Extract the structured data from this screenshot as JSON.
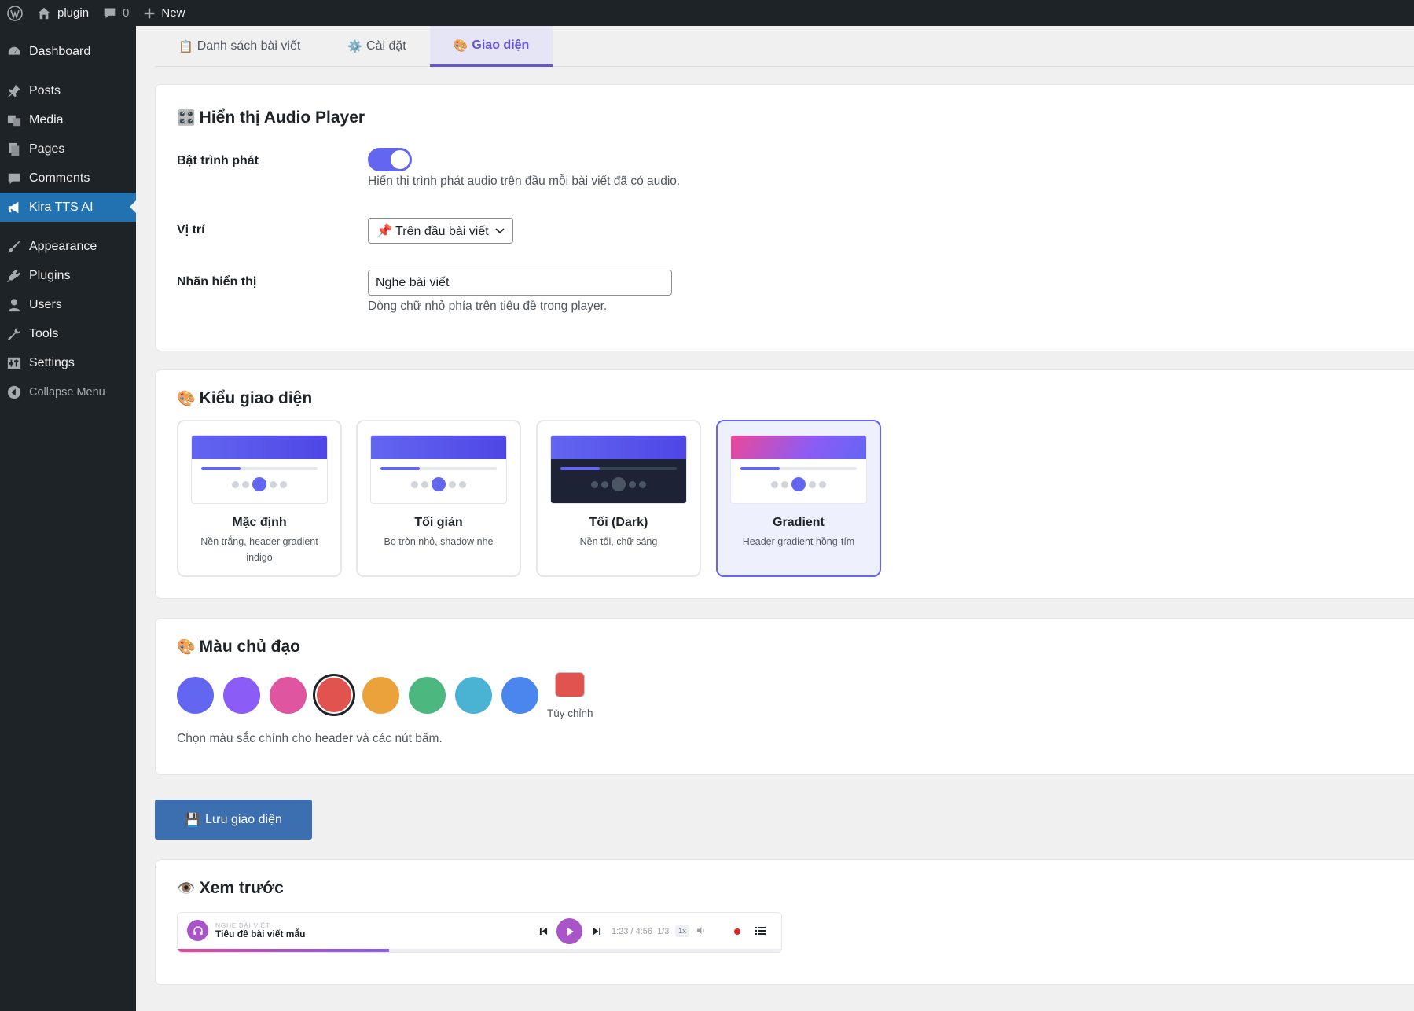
{
  "adminbar": {
    "site_name": "plugin",
    "comments_count": "0",
    "new_label": "New"
  },
  "sidebar": {
    "items": [
      {
        "label": "Dashboard",
        "icon": "dashboard-icon"
      },
      {
        "label": "Posts",
        "icon": "pin-icon"
      },
      {
        "label": "Media",
        "icon": "media-icon"
      },
      {
        "label": "Pages",
        "icon": "pages-icon"
      },
      {
        "label": "Comments",
        "icon": "comments-icon"
      },
      {
        "label": "Kira TTS AI",
        "icon": "megaphone-icon",
        "active": true
      },
      {
        "label": "Appearance",
        "icon": "brush-icon"
      },
      {
        "label": "Plugins",
        "icon": "plug-icon"
      },
      {
        "label": "Users",
        "icon": "user-icon"
      },
      {
        "label": "Tools",
        "icon": "wrench-icon"
      },
      {
        "label": "Settings",
        "icon": "settings-icon"
      },
      {
        "label": "Collapse Menu",
        "icon": "collapse-icon"
      }
    ]
  },
  "tabs": [
    {
      "emoji": "📋",
      "label": "Danh sách bài viết"
    },
    {
      "emoji": "⚙️",
      "label": "Cài đặt"
    },
    {
      "emoji": "🎨",
      "label": "Giao diện",
      "active": true
    }
  ],
  "player_section": {
    "emoji": "🎛️",
    "title": "Hiển thị Audio Player",
    "enable_label": "Bật trình phát",
    "enable_on": true,
    "enable_desc": "Hiển thị trình phát audio trên đầu mỗi bài viết đã có audio.",
    "position_label": "Vị trí",
    "position_value": "📌 Trên đầu bài viết",
    "display_label": "Nhãn hiển thị",
    "display_value": "Nghe bài viết",
    "display_desc": "Dòng chữ nhỏ phía trên tiêu đề trong player."
  },
  "theme_section": {
    "emoji": "🎨",
    "title": "Kiểu giao diện",
    "themes": [
      {
        "name": "Mặc định",
        "desc": "Nền trắng, header gradient indigo"
      },
      {
        "name": "Tối giản",
        "desc": "Bo tròn nhỏ, shadow nhẹ"
      },
      {
        "name": "Tối (Dark)",
        "desc": "Nền tối, chữ sáng"
      },
      {
        "name": "Gradient",
        "desc": "Header gradient hồng-tím",
        "selected": true
      }
    ]
  },
  "color_section": {
    "emoji": "🎨",
    "title": "Màu chủ đạo",
    "swatches": [
      "#6366f1",
      "#8b5cf6",
      "#e055a0",
      "#e0534e",
      "#ecA23a",
      "#4cb880",
      "#4ab3d4",
      "#4a86ee"
    ],
    "selected_index": 3,
    "custom_color": "#e0534e",
    "custom_label": "Tùy chỉnh",
    "desc": "Chọn màu sắc chính cho header và các nút bấm."
  },
  "save_button": {
    "emoji": "💾",
    "label": "Lưu giao diện"
  },
  "preview": {
    "emoji": "👁️",
    "title": "Xem trước",
    "kicker": "NGHE BÀI VIẾT",
    "post_title": "Tiêu đề bài viết mẫu",
    "time": "1:23 / 4:56",
    "part": "1/3",
    "speed": "1x",
    "progress": 0.35
  },
  "colors": {
    "accent": "#6366f1",
    "wp_blue": "#2271b1",
    "admin_dark": "#1d2327"
  }
}
